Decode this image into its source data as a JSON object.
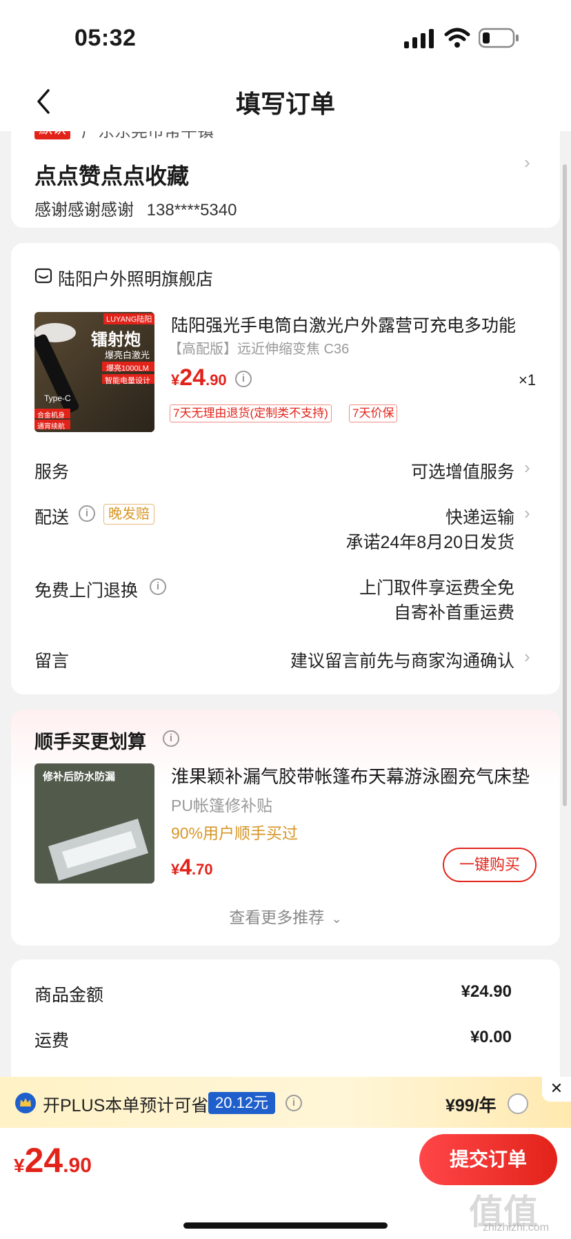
{
  "status_bar": {
    "time": "05:32"
  },
  "header": {
    "title": "填写订单"
  },
  "address": {
    "tag": "默认",
    "region": "广东东莞市常平镇",
    "name": "点点赞点点收藏",
    "contact_name": "感谢感谢感谢",
    "phone": "138****5340"
  },
  "store": {
    "name": "陆阳户外照明旗舰店"
  },
  "product": {
    "title": "陆阳强光手电筒白激光户外露营可充电多功能",
    "spec": "【高配版】远近伸缩变焦 C36",
    "price_symbol": "¥",
    "price_int": "24",
    "price_dec": ".90",
    "qty": "×1",
    "badges": [
      "7天无理由退货(定制类不支持)",
      "7天价保"
    ],
    "image_texts": {
      "brand": "LUYANG陆阳",
      "headline": "镭射炮",
      "sub": "爆亮白激光",
      "lm": "爆亮1000LM",
      "smart": "智能电量设计",
      "usb": "Type-C",
      "alloy": "合金机身",
      "endurance": "通宵续航"
    }
  },
  "service": {
    "label": "服务",
    "value": "可选增值服务"
  },
  "delivery": {
    "label": "配送",
    "tag": "晚发赔",
    "method": "快递运输",
    "promise": "承诺24年8月20日发货"
  },
  "return_service": {
    "label": "免费上门退换",
    "line1": "上门取件享运费全免",
    "line2": "自寄补首重运费"
  },
  "message": {
    "label": "留言",
    "placeholder": "建议留言前先与商家沟通确认"
  },
  "recommend": {
    "title": "顺手买更划算",
    "name": "淮果颖补漏气胶带帐篷布天幕游泳圈充气床垫",
    "sub": "PU帐篷修补贴",
    "ratio": "90%用户顺手买过",
    "price_symbol": "¥",
    "price_int": "4",
    "price_dec": ".70",
    "buy_label": "一键购买",
    "image_text": "修补后防水防漏",
    "more": "查看更多推荐"
  },
  "summary": {
    "goods_label": "商品金额",
    "goods_value": "¥24.90",
    "freight_label": "运费",
    "freight_value": "¥0.00"
  },
  "plus": {
    "text": "开PLUS本单预计可省",
    "amount": "20.12元",
    "price": "¥99/年",
    "close": "✕"
  },
  "bottom": {
    "total_symbol": "¥",
    "total_int": "24",
    "total_dec": ".90",
    "submit": "提交订单"
  },
  "watermark": {
    "logo": "值值值",
    "site": "zhizhizhi.com"
  },
  "colors": {
    "accent": "#e2231a",
    "plus_blue": "#1f5fcc",
    "orange": "#d79627"
  }
}
